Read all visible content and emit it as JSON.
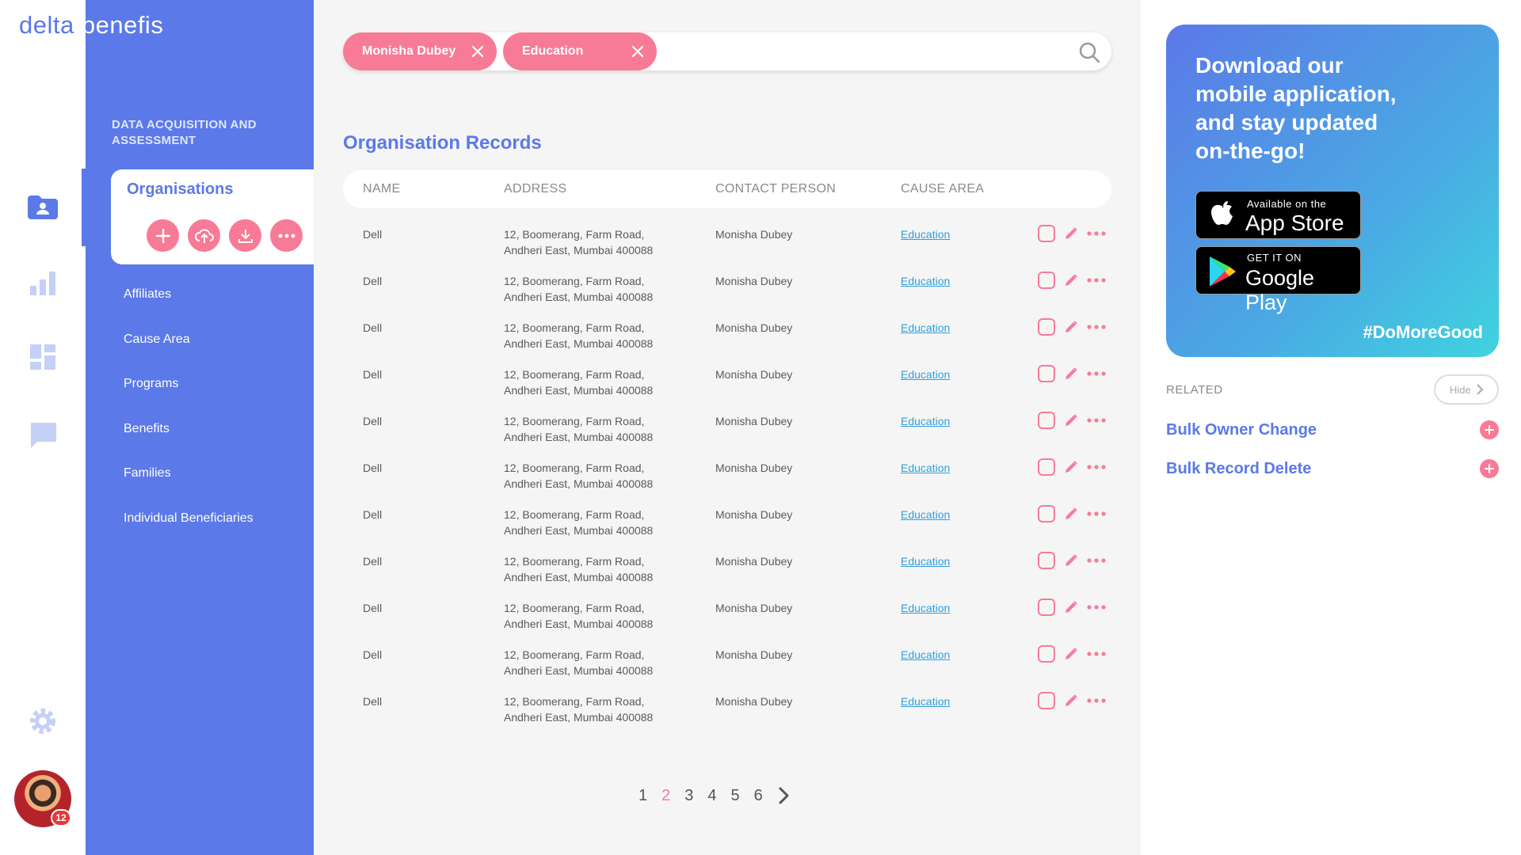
{
  "app": {
    "logo_part1": "delta",
    "logo_part2": "benefis"
  },
  "user": {
    "notification_count": "12"
  },
  "nav": {
    "section_title": "DATA ACQUISITION AND ASSESSMENT",
    "active_item": "Organisations",
    "items": [
      {
        "label": "Affiliates"
      },
      {
        "label": "Cause Area"
      },
      {
        "label": "Programs"
      },
      {
        "label": "Benefits"
      },
      {
        "label": "Families"
      },
      {
        "label": "Individual Beneficiaries"
      }
    ]
  },
  "search": {
    "chips": [
      {
        "label": "Monisha Dubey"
      },
      {
        "label": "Education"
      }
    ]
  },
  "main": {
    "title": "Organisation Records",
    "columns": {
      "name": "NAME",
      "address": "ADDRESS",
      "contact": "CONTACT PERSON",
      "cause": "CAUSE AREA"
    },
    "rows": [
      {
        "name": "Dell",
        "address_line1": "12, Boomerang, Farm Road,",
        "address_line2": "Andheri East, Mumbai 400088",
        "contact": "Monisha Dubey",
        "cause": "Education"
      },
      {
        "name": "Dell",
        "address_line1": "12, Boomerang, Farm Road,",
        "address_line2": "Andheri East, Mumbai 400088",
        "contact": "Monisha Dubey",
        "cause": "Education"
      },
      {
        "name": "Dell",
        "address_line1": "12, Boomerang, Farm Road,",
        "address_line2": "Andheri East, Mumbai 400088",
        "contact": "Monisha Dubey",
        "cause": "Education"
      },
      {
        "name": "Dell",
        "address_line1": "12, Boomerang, Farm Road,",
        "address_line2": "Andheri East, Mumbai 400088",
        "contact": "Monisha Dubey",
        "cause": "Education"
      },
      {
        "name": "Dell",
        "address_line1": "12, Boomerang, Farm Road,",
        "address_line2": "Andheri East, Mumbai 400088",
        "contact": "Monisha Dubey",
        "cause": "Education"
      },
      {
        "name": "Dell",
        "address_line1": "12, Boomerang, Farm Road,",
        "address_line2": "Andheri East, Mumbai 400088",
        "contact": "Monisha Dubey",
        "cause": "Education"
      },
      {
        "name": "Dell",
        "address_line1": "12, Boomerang, Farm Road,",
        "address_line2": "Andheri East, Mumbai 400088",
        "contact": "Monisha Dubey",
        "cause": "Education"
      },
      {
        "name": "Dell",
        "address_line1": "12, Boomerang, Farm Road,",
        "address_line2": "Andheri East, Mumbai 400088",
        "contact": "Monisha Dubey",
        "cause": "Education"
      },
      {
        "name": "Dell",
        "address_line1": "12, Boomerang, Farm Road,",
        "address_line2": "Andheri East, Mumbai 400088",
        "contact": "Monisha Dubey",
        "cause": "Education"
      },
      {
        "name": "Dell",
        "address_line1": "12, Boomerang, Farm Road,",
        "address_line2": "Andheri East, Mumbai 400088",
        "contact": "Monisha Dubey",
        "cause": "Education"
      },
      {
        "name": "Dell",
        "address_line1": "12, Boomerang, Farm Road,",
        "address_line2": "Andheri East, Mumbai 400088",
        "contact": "Monisha Dubey",
        "cause": "Education"
      }
    ],
    "pagination": {
      "pages": [
        "1",
        "2",
        "3",
        "4",
        "5",
        "6"
      ],
      "current": "2"
    }
  },
  "promo": {
    "line1": "Download our",
    "line2": "mobile application,",
    "line3": "and stay updated",
    "line4": "on-the-go!",
    "appstore_small": "Available on the",
    "appstore_big": "App Store",
    "googleplay_small": "GET IT ON",
    "googleplay_big": "Google Play",
    "hashtag": "#DoMoreGood"
  },
  "related": {
    "label": "RELATED",
    "hide_label": "Hide",
    "items": [
      {
        "label": "Bulk Owner Change"
      },
      {
        "label": "Bulk Record Delete"
      }
    ]
  },
  "colors": {
    "primary": "#5B79E8",
    "accent": "#F77B96",
    "link": "#2E9FE0"
  },
  "icons": [
    "contacts-icon",
    "bar-chart-icon",
    "dashboard-icon",
    "chat-icon",
    "settings-icon",
    "search-icon",
    "close-icon",
    "plus-icon",
    "upload-cloud-icon",
    "download-icon",
    "more-icon",
    "edit-icon",
    "apple-icon",
    "google-play-icon",
    "chevron-right-icon"
  ]
}
